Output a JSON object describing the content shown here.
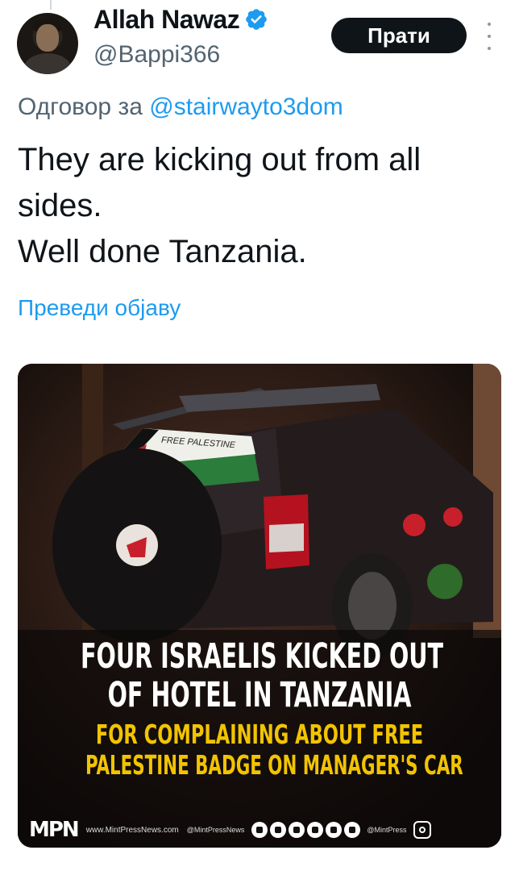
{
  "author": {
    "display_name": "Allah Nawaz",
    "handle": "@Bappi366",
    "verified": true,
    "avatar_icon": "profile-avatar"
  },
  "follow_label": "Прати",
  "reply_to": {
    "prefix": "Одговор за",
    "mention": "@stairwayto3dom"
  },
  "tweet_text": {
    "line1": "They are kicking out from all",
    "line2": "sides.",
    "line3": "Well done Tanzania."
  },
  "translate_label": "Преведи објаву",
  "media": {
    "car_sticker_text": "FREE PALESTINE",
    "headline_line1": "FOUR ISRAELIS KICKED OUT",
    "headline_line2": "OF HOTEL IN TANZANIA",
    "subhead_line1": "FOR COMPLAINING ABOUT FREE",
    "subhead_line2": "PALESTINE BADGE ON MANAGER'S CAR",
    "footer": {
      "logo_text": "MPN",
      "url": "www.MintPressNews.com",
      "handle": "@MintPressNews",
      "handle2": "@MintPress"
    }
  },
  "colors": {
    "accent": "#1d9bf0",
    "text_primary": "#0f1419",
    "text_secondary": "#536471",
    "follow_bg": "#0f1419",
    "headline_yellow": "#f2c400"
  }
}
